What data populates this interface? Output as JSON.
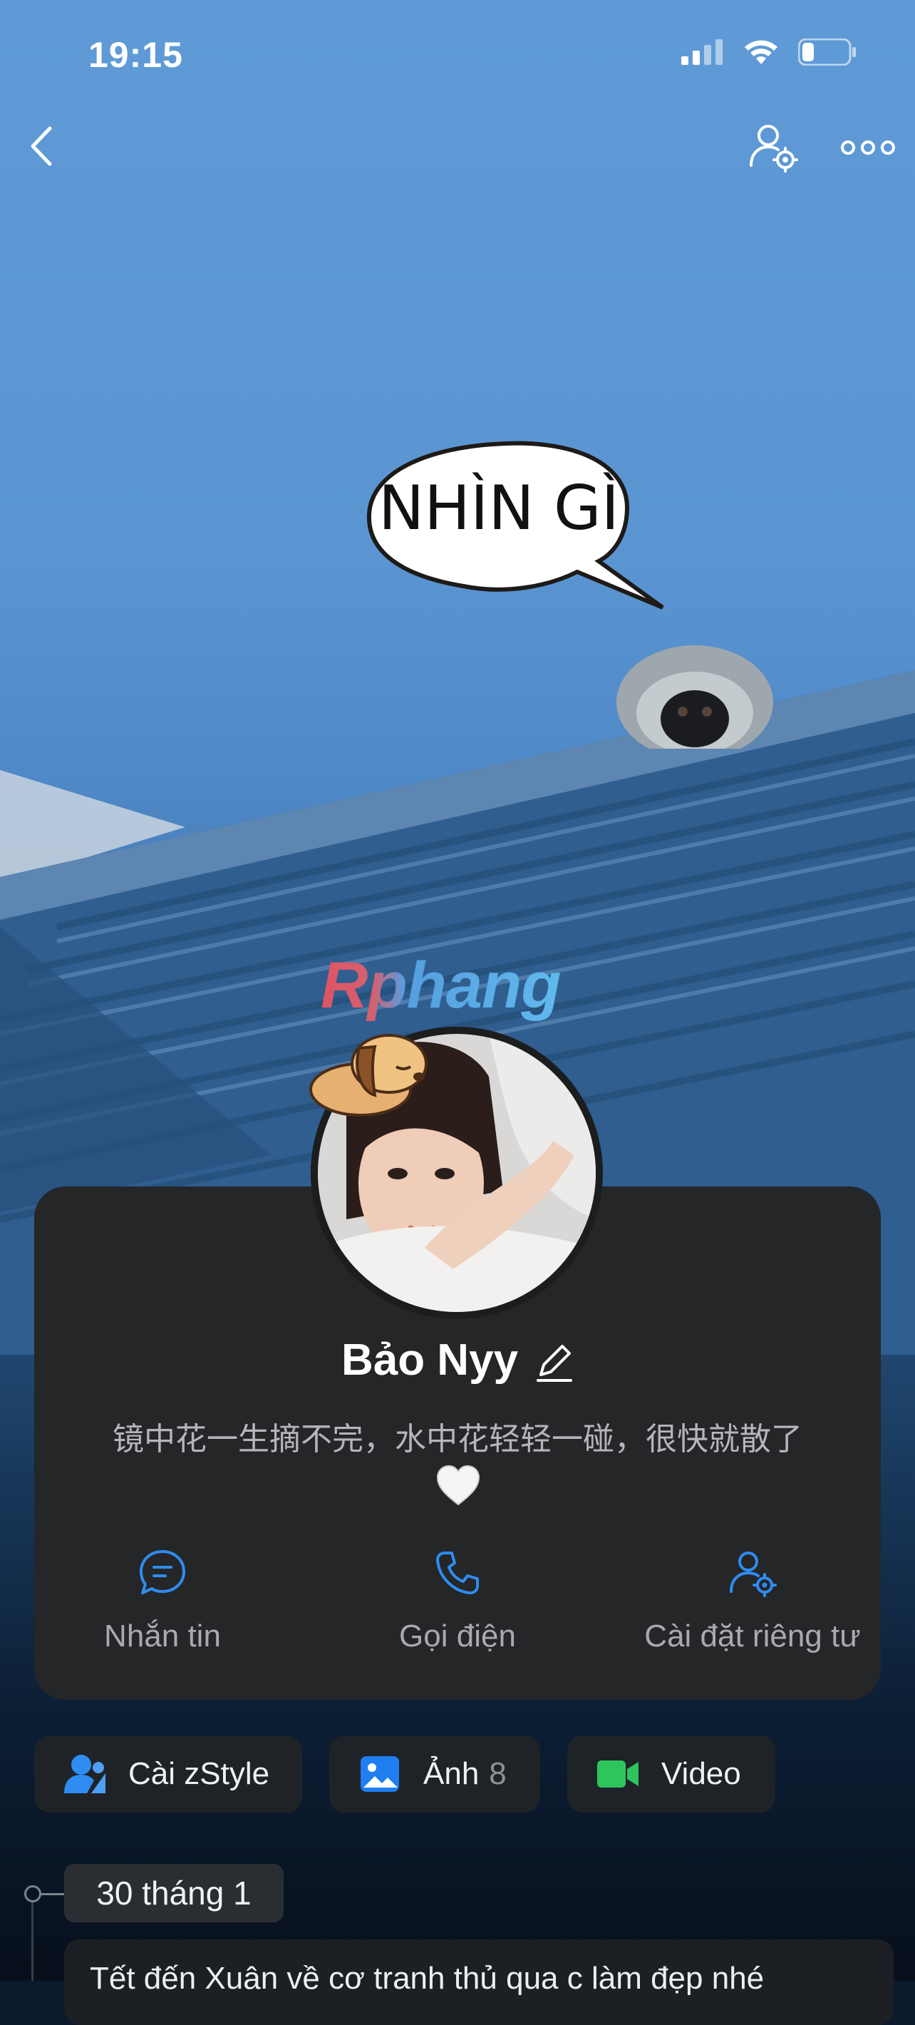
{
  "status_bar": {
    "time": "19:15"
  },
  "cover": {
    "speech_bubble": "NHÌN GÌ",
    "watermark": "Rphang"
  },
  "profile": {
    "name": "Bảo Nyy",
    "bio": "镜中花一生摘不完，水中花轻轻一碰，很快就散了"
  },
  "actions": [
    {
      "label": "Nhắn tin",
      "icon": "message-icon"
    },
    {
      "label": "Gọi điện",
      "icon": "phone-icon"
    },
    {
      "label": "Cài đặt riêng tư",
      "icon": "privacy-settings-icon"
    }
  ],
  "chips": [
    {
      "label": "Cài zStyle",
      "icon": "zstyle-icon"
    },
    {
      "label": "Ảnh",
      "count": "8",
      "icon": "photo-icon"
    },
    {
      "label": "Video",
      "icon": "video-icon"
    }
  ],
  "timeline": {
    "date": "30 tháng 1",
    "post_text": "Tết đến Xuân về cơ tranh thủ qua c làm đẹp nhé"
  },
  "colors": {
    "accent": "#2f8cf0",
    "card": "#242628",
    "video_green": "#2ec55d"
  }
}
